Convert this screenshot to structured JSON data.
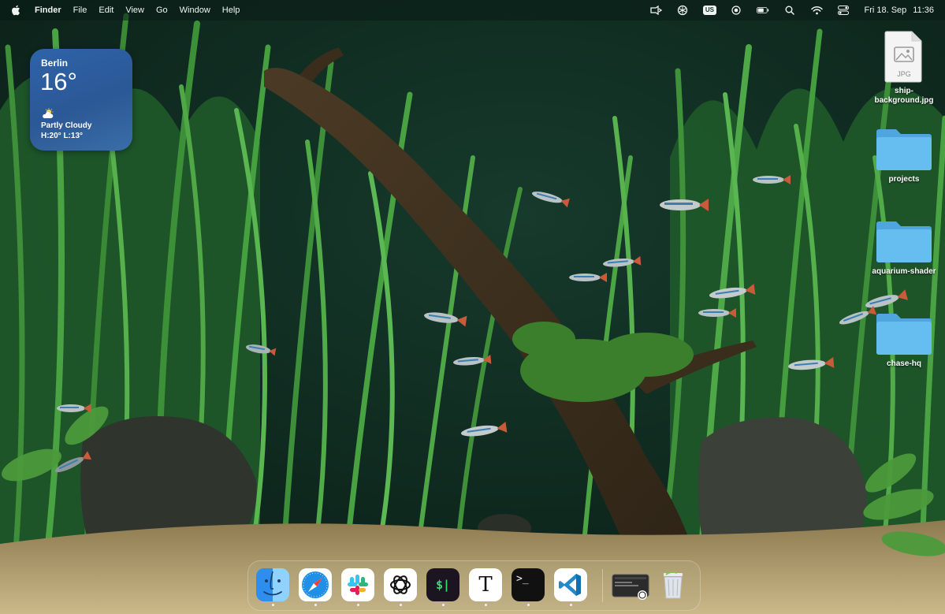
{
  "menubar": {
    "app_name": "Finder",
    "menus": [
      "File",
      "Edit",
      "View",
      "Go",
      "Window",
      "Help"
    ],
    "input_source": "US",
    "date": "Fri 18. Sep",
    "time": "11:36",
    "status_icons": [
      "cast-icon",
      "chatgpt-icon",
      "keyboard-input-icon",
      "screen-record-icon",
      "battery-icon",
      "spotlight-search-icon",
      "wifi-icon",
      "control-center-icon"
    ]
  },
  "weather_widget": {
    "city": "Berlin",
    "temperature": "16°",
    "condition": "Partly Cloudy",
    "range": "H:20° L:13°",
    "icon": "partly-cloudy-icon",
    "color": "#2e63a8"
  },
  "desktop_icons": [
    {
      "label": "ship-background.jpg",
      "type": "jpg-file-icon",
      "badge": "JPG"
    },
    {
      "label": "projects",
      "type": "folder-icon"
    },
    {
      "label": "aquarium-shader",
      "type": "folder-icon"
    },
    {
      "label": "chase-hq",
      "type": "folder-icon"
    }
  ],
  "dock": {
    "apps": [
      "finder",
      "safari",
      "slack",
      "chatgpt",
      "terminal-dollar",
      "typora",
      "terminal",
      "visual-studio-code",
      "recent-window",
      "trash"
    ],
    "running": [
      "finder",
      "safari",
      "slack",
      "chatgpt",
      "terminal-dollar",
      "typora",
      "terminal",
      "visual-studio-code"
    ],
    "terminal_dollar_glyph": "$|",
    "typora_glyph": "T",
    "terminal_glyph": ">_"
  }
}
